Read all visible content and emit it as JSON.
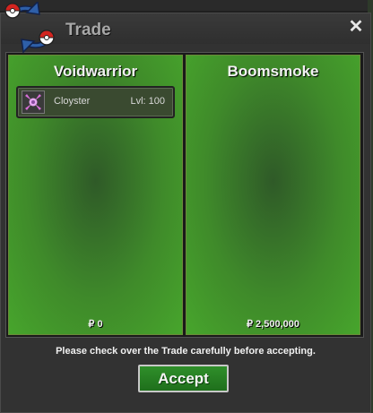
{
  "window": {
    "title": "Trade",
    "close_symbol": "✕"
  },
  "left_panel": {
    "player_name": "Voidwarrior",
    "item": {
      "name": "Cloyster",
      "level": "Lvl: 100"
    },
    "money": "₽ 0"
  },
  "right_panel": {
    "player_name": "Boomsmoke",
    "money": "₽ 2,500,000"
  },
  "notice": "Please check over the Trade carefully before accepting.",
  "accept_label": "Accept",
  "colors": {
    "panel_green": "#3f8a2a",
    "accept_green": "#1f6f1c",
    "window_bg": "#323232",
    "logo_blue": "#2e5fa8",
    "logo_red": "#d3241f"
  },
  "icons": {
    "logo": "trade-swap-logo",
    "close": "close-icon",
    "item": "cloyster-icon"
  }
}
